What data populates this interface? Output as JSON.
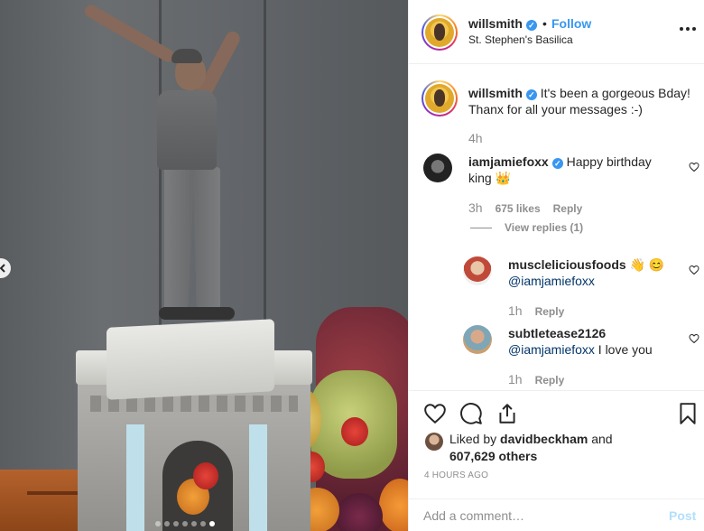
{
  "header": {
    "username": "willsmith",
    "follow_label": "Follow",
    "location": "St. Stephen's Basilica",
    "separator": "•"
  },
  "caption": {
    "username": "willsmith",
    "text": "It's been a gorgeous Bday! Thanx for all your messages :-)",
    "time": "4h"
  },
  "comments": [
    {
      "username": "iamjamiefoxx",
      "text": "Happy birthday king 👑",
      "time": "3h",
      "likes": "675 likes",
      "reply_label": "Reply",
      "view_replies": "View replies (1)"
    }
  ],
  "replies": [
    {
      "username": "muscleliciousfoods",
      "emoji": "👋 😊",
      "mention": "@iamjamiefoxx",
      "text": "",
      "time": "1h",
      "reply_label": "Reply"
    },
    {
      "username": "subtletease2126",
      "emoji": "",
      "mention": "@iamjamiefoxx",
      "text": "I love you",
      "time": "1h",
      "reply_label": "Reply"
    }
  ],
  "likes": {
    "prefix": "Liked by",
    "top_liker": "davidbeckham",
    "joiner": "and",
    "others": "607,629 others"
  },
  "timestamp": "4 HOURS AGO",
  "comment_box": {
    "placeholder": "Add a comment…",
    "post_label": "Post"
  },
  "carousel": {
    "count": 7,
    "active_index": 6
  },
  "colors": {
    "accent": "#3897f0",
    "text": "#262626",
    "muted": "#8e8e8e",
    "post_disabled": "#b2dffc"
  },
  "icons": [
    "heart-icon",
    "comment-icon",
    "share-icon",
    "bookmark-icon",
    "more-options-icon",
    "verified-badge-icon"
  ]
}
